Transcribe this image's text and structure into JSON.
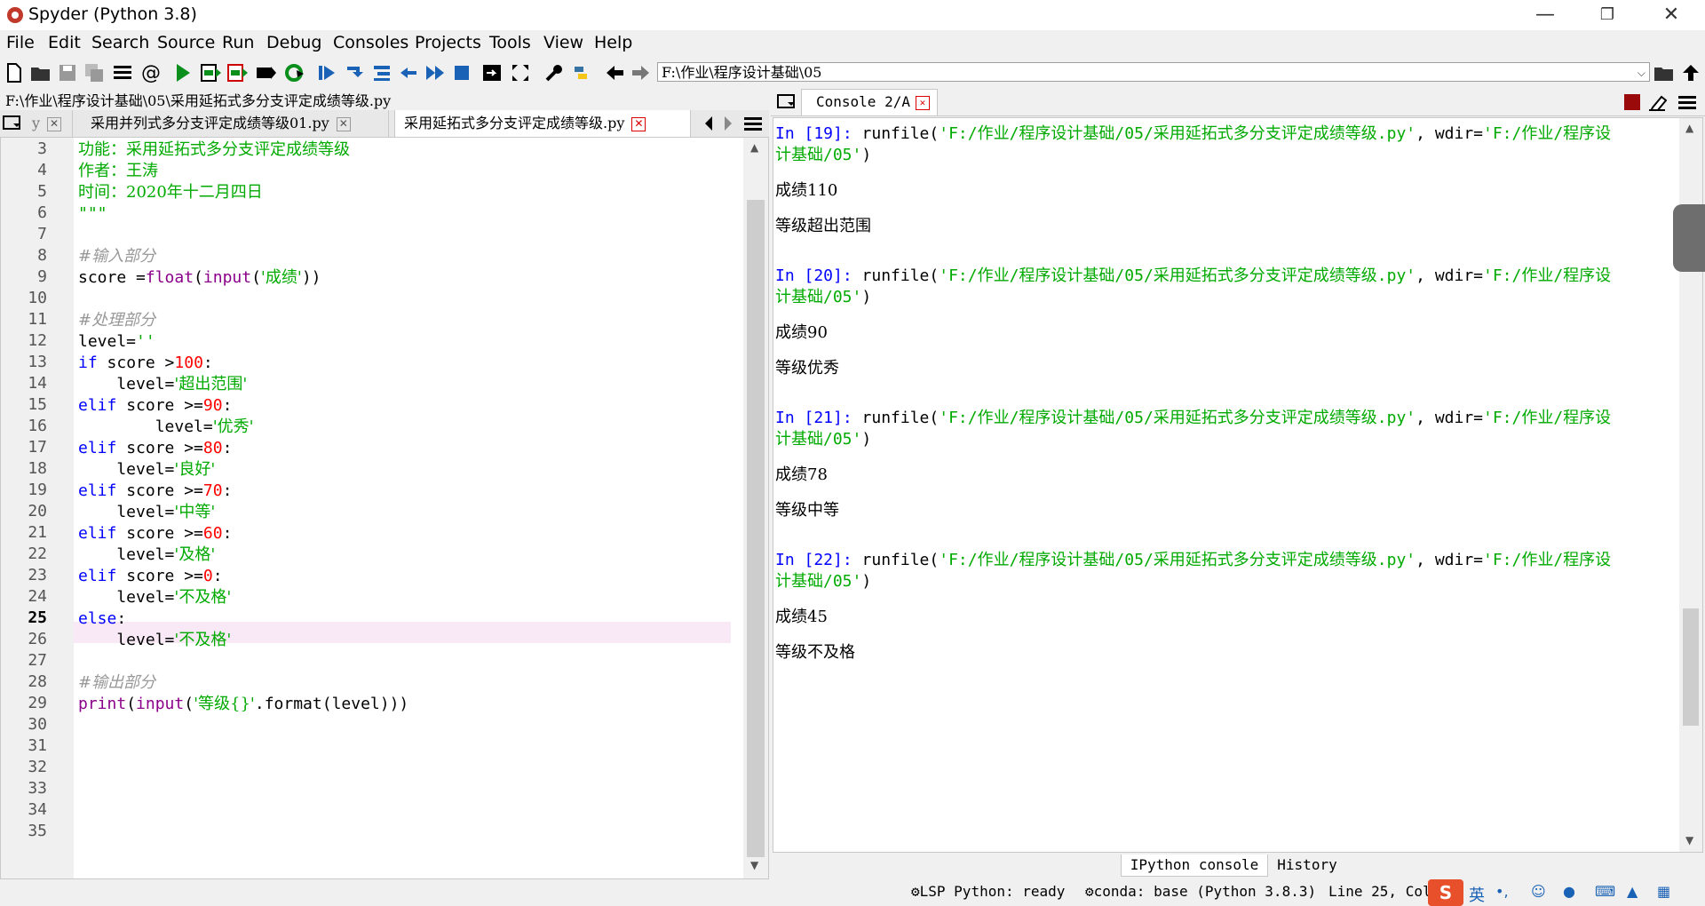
{
  "window": {
    "title": "Spyder (Python 3.8)"
  },
  "menu": [
    "File",
    "Edit",
    "Search",
    "Source",
    "Run",
    "Debug",
    "Consoles",
    "Projects",
    "Tools",
    "View",
    "Help"
  ],
  "toolbar": {
    "path": "F:\\作业\\程序设计基础\\05"
  },
  "editor": {
    "filepath": "F:\\作业\\程序设计基础\\05\\采用延拓式多分支评定成绩等级.py",
    "tabs": [
      {
        "label": "y"
      },
      {
        "label": "采用并列式多分支评定成绩等级01.py"
      },
      {
        "label": "采用延拓式多分支评定成绩等级.py"
      }
    ],
    "line_numbers": [
      "3",
      "4",
      "5",
      "6",
      "7",
      "8",
      "9",
      "10",
      "11",
      "12",
      "13",
      "14",
      "15",
      "16",
      "17",
      "18",
      "19",
      "20",
      "21",
      "22",
      "23",
      "24",
      "25",
      "26",
      "27",
      "28",
      "29",
      "30",
      "31",
      "32",
      "33",
      "34",
      "35"
    ],
    "code": {
      "l3": "功能：采用延拓式多分支评定成绩等级",
      "l4": "作者：王涛",
      "l5": "时间：2020年十二月四日",
      "l6": "\"\"\"",
      "l8": "#输入部分",
      "l9_a": "score =",
      "l9_fn1": "float",
      "l9_b": "(",
      "l9_fn2": "input",
      "l9_c": "(",
      "l9_str": "'成绩'",
      "l9_d": "))",
      "l11": "#处理部分",
      "l12_a": "level=",
      "l12_str": "''",
      "l13_kw": "if",
      "l13_a": " score >",
      "l13_num": "100",
      "l13_b": ":",
      "l14_a": "    level=",
      "l14_str": "'超出范围'",
      "l15_kw": "elif",
      "l15_a": " score >=",
      "l15_num": "90",
      "l15_b": ":",
      "l16_a": "        level=",
      "l16_str": "'优秀'",
      "l17_kw": "elif",
      "l17_a": " score >=",
      "l17_num": "80",
      "l17_b": ":",
      "l18_a": "    level=",
      "l18_str": "'良好'",
      "l19_kw": "elif",
      "l19_a": " score >=",
      "l19_num": "70",
      "l19_b": ":",
      "l20_a": "    level=",
      "l20_str": "'中等'",
      "l21_kw": "elif",
      "l21_a": " score >=",
      "l21_num": "60",
      "l21_b": ":",
      "l22_a": "    level=",
      "l22_str": "'及格'",
      "l23_kw": "elif",
      "l23_a": " score >=",
      "l23_num": "0",
      "l23_b": ":",
      "l24_a": "    level=",
      "l24_str": "'不及格'",
      "l25_kw": "else",
      "l25_a": ":",
      "l26_a": "    level=",
      "l26_str": "'不及格'",
      "l28": "#输出部分",
      "l29_fn1": "print",
      "l29_a": "(",
      "l29_fn2": "input",
      "l29_b": "(",
      "l29_str": "'等级{}'",
      "l29_c": ".format(level)))"
    }
  },
  "console": {
    "tab_label": "Console 2/A",
    "entries": [
      {
        "prompt": "In [19]:",
        "cmd_a": " runfile(",
        "path": "'F:/作业/程序设计基础/05/采用延拓式多分支评定成绩等级.py'",
        "cmd_b": ", wdir=",
        "wdir1": "'F:/作业/程序设",
        "wdir2": "计基础/05'",
        "close": ")",
        "out1": "成绩110",
        "out2": "等级超出范围"
      },
      {
        "prompt": "In [20]:",
        "cmd_a": " runfile(",
        "path": "'F:/作业/程序设计基础/05/采用延拓式多分支评定成绩等级.py'",
        "cmd_b": ", wdir=",
        "wdir1": "'F:/作业/程序设",
        "wdir2": "计基础/05'",
        "close": ")",
        "out1": "成绩90",
        "out2": "等级优秀"
      },
      {
        "prompt": "In [21]:",
        "cmd_a": " runfile(",
        "path": "'F:/作业/程序设计基础/05/采用延拓式多分支评定成绩等级.py'",
        "cmd_b": ", wdir=",
        "wdir1": "'F:/作业/程序设",
        "wdir2": "计基础/05'",
        "close": ")",
        "out1": "成绩78",
        "out2": "等级中等"
      },
      {
        "prompt": "In [22]:",
        "cmd_a": " runfile(",
        "path": "'F:/作业/程序设计基础/05/采用延拓式多分支评定成绩等级.py'",
        "cmd_b": ", wdir=",
        "wdir1": "'F:/作业/程序设",
        "wdir2": "计基础/05'",
        "close": ")",
        "out1": "成绩45",
        "out2": "等级不及格"
      }
    ],
    "bottom_tabs": [
      "IPython console",
      "History"
    ]
  },
  "status": {
    "lsp": "LSP Python: ready",
    "conda": "conda: base (Python 3.8.3)",
    "position": "Line 25, Col"
  },
  "ime": {
    "lang": "英"
  },
  "colors": {
    "keyword": "#0000ff",
    "string": "#00aa00",
    "builtin": "#8b008b",
    "comment": "#999999",
    "number": "#ff0000",
    "current_line": "#f9e8f6"
  }
}
